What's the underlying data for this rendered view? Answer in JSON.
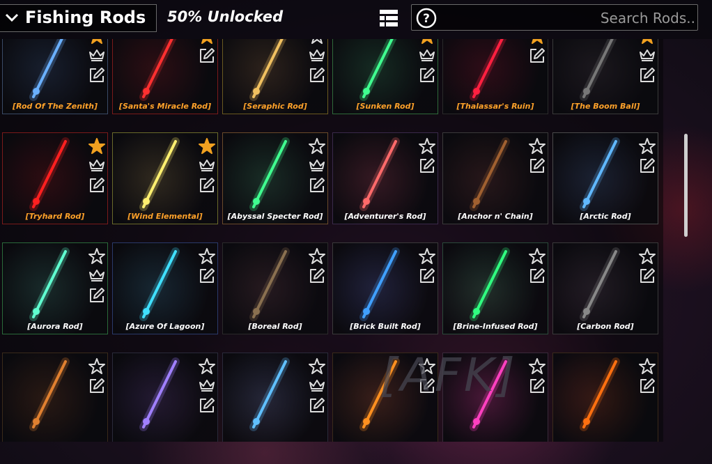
{
  "header": {
    "title": "Fishing Rods",
    "progress_text": "50% Unlocked",
    "search_placeholder": "Search Rods.."
  },
  "overlay": {
    "afk_text": "[AFK]"
  },
  "colors": {
    "gold_label": "#ffa22a",
    "white_label": "#ffffff",
    "star_active": "#f0a020"
  },
  "rods": [
    {
      "label": "[Rod Of The Zenith]",
      "style": "gold",
      "favorited": true,
      "crown": true,
      "border": "#3a4a66",
      "glow": "#6ab0ff"
    },
    {
      "label": "[Santa's Miracle Rod]",
      "style": "gold",
      "favorited": true,
      "crown": false,
      "border": "#7a1a1a",
      "glow": "#ff3030"
    },
    {
      "label": "[Seraphic Rod]",
      "style": "gold",
      "favorited": false,
      "crown": true,
      "border": "#6a5a20",
      "glow": "#f0c060"
    },
    {
      "label": "[Sunken Rod]",
      "style": "gold",
      "favorited": true,
      "crown": true,
      "border": "#2f6a3a",
      "glow": "#40ff90"
    },
    {
      "label": "[Thalassar's Ruin]",
      "style": "gold",
      "favorited": true,
      "crown": false,
      "border": "#2a2a2a",
      "glow": "#ff2040"
    },
    {
      "label": "[The Boom Ball]",
      "style": "gold",
      "favorited": true,
      "crown": true,
      "border": "#3a3a3a",
      "glow": "#777777"
    },
    {
      "label": "[Tryhard Rod]",
      "style": "gold",
      "favorited": true,
      "crown": true,
      "border": "#7a1a1a",
      "glow": "#ff2020"
    },
    {
      "label": "[Wind Elemental]",
      "style": "gold",
      "favorited": true,
      "crown": true,
      "border": "#6a6a2a",
      "glow": "#fff070"
    },
    {
      "label": "[Abyssal Specter Rod]",
      "style": "white",
      "favorited": false,
      "crown": true,
      "border": "#6a4a2a",
      "glow": "#40ff90"
    },
    {
      "label": "[Adventurer's Rod]",
      "style": "white",
      "favorited": false,
      "crown": false,
      "border": "#3a2a4a",
      "glow": "#ff6a6a"
    },
    {
      "label": "[Anchor n' Chain]",
      "style": "white",
      "favorited": false,
      "crown": false,
      "border": "#3a3a3a",
      "glow": "#a06030"
    },
    {
      "label": "[Arctic Rod]",
      "style": "white",
      "favorited": false,
      "crown": false,
      "border": "#4a4a4a",
      "glow": "#60b8ff"
    },
    {
      "label": "[Aurora Rod]",
      "style": "white",
      "favorited": false,
      "crown": true,
      "border": "#2a6a3a",
      "glow": "#60ffd0"
    },
    {
      "label": "[Azure Of Lagoon]",
      "style": "white",
      "favorited": false,
      "crown": false,
      "border": "#2a3a6a",
      "glow": "#40e0ff"
    },
    {
      "label": "[Boreal Rod]",
      "style": "white",
      "favorited": false,
      "crown": false,
      "border": "#2a2a2a",
      "glow": "#8a7050"
    },
    {
      "label": "[Brick Built Rod]",
      "style": "white",
      "favorited": false,
      "crown": false,
      "border": "#3a3a3a",
      "glow": "#40a0ff"
    },
    {
      "label": "[Brine-Infused Rod]",
      "style": "white",
      "favorited": false,
      "crown": false,
      "border": "#2a4a3a",
      "glow": "#30ff80"
    },
    {
      "label": "[Carbon Rod]",
      "style": "white",
      "favorited": false,
      "crown": false,
      "border": "#3a3a3a",
      "glow": "#888888"
    },
    {
      "label": "",
      "style": "white",
      "favorited": false,
      "crown": false,
      "border": "#3a2a1a",
      "glow": "#e08030"
    },
    {
      "label": "",
      "style": "white",
      "favorited": false,
      "crown": true,
      "border": "#2a2a3a",
      "glow": "#a080ff"
    },
    {
      "label": "",
      "style": "white",
      "favorited": false,
      "crown": true,
      "border": "#2a2a3a",
      "glow": "#60c0ff"
    },
    {
      "label": "",
      "style": "white",
      "favorited": false,
      "crown": false,
      "border": "#3a2a1a",
      "glow": "#ff9020"
    },
    {
      "label": "",
      "style": "white",
      "favorited": false,
      "crown": false,
      "border": "#3a2a3a",
      "glow": "#ff40c0"
    },
    {
      "label": "",
      "style": "white",
      "favorited": false,
      "crown": false,
      "border": "#3a2a1a",
      "glow": "#ff7010"
    }
  ]
}
